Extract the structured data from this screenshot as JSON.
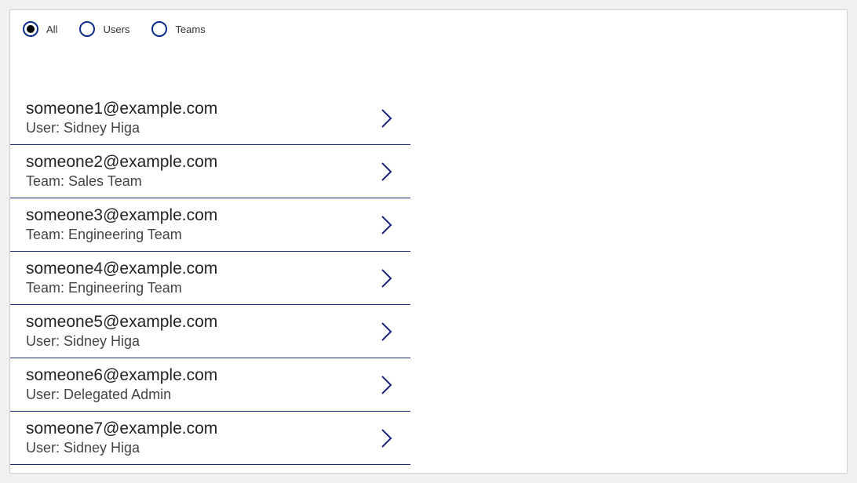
{
  "filters": {
    "options": [
      {
        "key": "all",
        "label": "All",
        "selected": true
      },
      {
        "key": "users",
        "label": "Users",
        "selected": false
      },
      {
        "key": "teams",
        "label": "Teams",
        "selected": false
      }
    ]
  },
  "list": {
    "items": [
      {
        "email": "someone1@example.com",
        "detail": "User: Sidney Higa"
      },
      {
        "email": "someone2@example.com",
        "detail": "Team: Sales Team"
      },
      {
        "email": "someone3@example.com",
        "detail": "Team: Engineering Team"
      },
      {
        "email": "someone4@example.com",
        "detail": "Team: Engineering Team"
      },
      {
        "email": "someone5@example.com",
        "detail": "User: Sidney Higa"
      },
      {
        "email": "someone6@example.com",
        "detail": "User: Delegated Admin"
      },
      {
        "email": "someone7@example.com",
        "detail": "User: Sidney Higa"
      }
    ]
  }
}
